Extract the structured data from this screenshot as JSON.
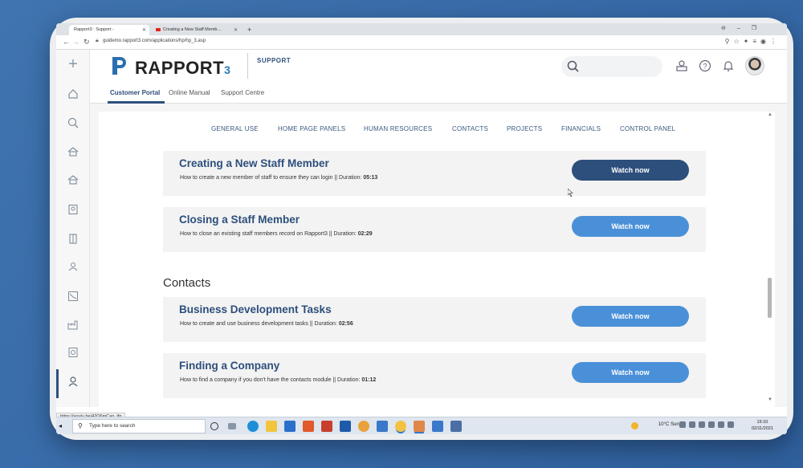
{
  "browser": {
    "tabs": [
      {
        "label": "Rapport3 : Support -",
        "active": true
      },
      {
        "label": "Creating a New Staff Memb…",
        "active": false
      }
    ],
    "url": "guidemo.rapport3.com/applications/hp/hp_3.asp",
    "status_url": "https://youtu.be/42Q6mCap_tfg"
  },
  "app": {
    "logo_text": "RAPPORT",
    "logo_suffix": "3",
    "section_label": "SUPPORT",
    "subtabs": [
      "Customer Portal",
      "Online Manual",
      "Support Centre"
    ],
    "active_subtab": "Customer Portal",
    "sidebar_icons": [
      "add-icon",
      "home-icon",
      "search-person-icon",
      "team-icon",
      "org-icon",
      "contact-card-icon",
      "building-icon",
      "people-icon",
      "chart-icon",
      "factory-icon",
      "report-icon",
      "user-icon"
    ]
  },
  "categories": [
    "GENERAL USE",
    "HOME PAGE PANELS",
    "HUMAN RESOURCES",
    "CONTACTS",
    "PROJECTS",
    "FINANCIALS",
    "CONTROL PANEL"
  ],
  "hr_videos": [
    {
      "title": "Creating a New Staff Member",
      "desc": "How to create a new member of staff to ensure they can login || Duration: ",
      "duration": "05:13",
      "button": "Watch now",
      "hovered": true
    },
    {
      "title": "Closing a Staff Member",
      "desc": "How to close an existing staff members record on Rapport3 || Duration: ",
      "duration": "02:29",
      "button": "Watch now",
      "hovered": false
    }
  ],
  "contacts_section": {
    "title": "Contacts",
    "videos": [
      {
        "title": "Business Development Tasks",
        "desc": "How to create and use business development tasks || Duration: ",
        "duration": "02:56",
        "button": "Watch now"
      },
      {
        "title": "Finding a Company",
        "desc": "How to find a company if you don't have the contacts module || Duration: ",
        "duration": "01:12",
        "button": "Watch now"
      }
    ]
  },
  "taskbar": {
    "search_placeholder": "Type here to search",
    "weather": "10°C  Sunny",
    "time": "15:10",
    "date": "02/11/2021"
  },
  "colors": {
    "brand": "#2d4f7c",
    "button": "#4a90d9",
    "button_hover": "#2d4f7c",
    "card_bg": "#f3f3f3"
  }
}
